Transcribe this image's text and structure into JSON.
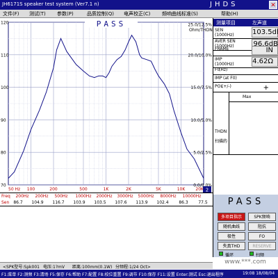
{
  "window": {
    "title": "JH6171S speaker test system (Ver7.1 n)",
    "brand": "JHDS",
    "close_icon": "close-icon"
  },
  "menu": [
    {
      "label": "文件(F)"
    },
    {
      "label": "测试(T)"
    },
    {
      "label": "参数(P)"
    },
    {
      "label": "品质控制(Q)"
    },
    {
      "label": "电声校正(C)"
    },
    {
      "label": "频响曲线标准(S)"
    },
    {
      "label": "帮助(H)"
    }
  ],
  "chart_banner": "PASS",
  "chart_data": {
    "type": "line",
    "title": "",
    "xlabel": "Freq",
    "ylabel_left": "",
    "ylabel_right": "Ohm/THDN",
    "x_scale": "log",
    "xlim": [
      50,
      20000
    ],
    "ylim_left": [
      70,
      120
    ],
    "ylim_right": [
      0,
      25
    ],
    "grid": true,
    "x_ticks": [
      "50 Hz",
      "100",
      "200",
      "500",
      "1K",
      "2K",
      "5K",
      "10K",
      "20K"
    ],
    "y_ticks_left": [
      "120",
      "110",
      "100",
      "90",
      "80",
      "70"
    ],
    "y_ticks_right": [
      "25.0/12.5%",
      "20.0/10.0%",
      "15.0/7.5%",
      "10.0/5.0%",
      "5.0/2.5%",
      "0.0/0.0%"
    ],
    "series": [
      {
        "axis": "left",
        "color": "#12128a",
        "x": [
          50,
          60,
          80,
          100,
          130,
          160,
          200,
          220,
          250,
          300,
          400,
          500,
          600,
          700,
          800,
          900,
          1000,
          1100,
          1200,
          1400,
          1600,
          1800,
          2000,
          2200,
          2500,
          2800,
          3000,
          3500,
          4000,
          4500,
          5000,
          6000,
          7000,
          8000,
          10000,
          12000,
          15000,
          20000
        ],
        "y": [
          72.0,
          74.0,
          80.5,
          87.0,
          93.0,
          98.5,
          106.0,
          111.5,
          115.0,
          111.0,
          107.0,
          105.0,
          103.5,
          103.0,
          103.5,
          103.5,
          103.0,
          104.5,
          106.5,
          108.5,
          109.5,
          111.5,
          114.0,
          116.0,
          114.0,
          110.0,
          109.0,
          108.5,
          108.0,
          105.5,
          103.5,
          101.0,
          98.0,
          93.0,
          86.0,
          81.0,
          78.0,
          72.0
        ]
      }
    ],
    "readout": {
      "freq_label": "Freq",
      "sen_label": "Sen",
      "freqs": [
        "200Hz",
        "200Hz",
        "500Hz",
        "1000Hz",
        "2000Hz",
        "3000Hz",
        "5000Hz",
        "8000Hz",
        "10000Hz"
      ],
      "values": [
        "86.7",
        "104.9",
        "116.7",
        "103.9",
        "103.5",
        "107.6",
        "113.9",
        "102.4",
        "86.3",
        "77.5"
      ]
    },
    "scroll_value": "2"
  },
  "right_panel": {
    "header_left": "测量项目",
    "header_right": "左声道",
    "rows": [
      {
        "label": "SEN",
        "unit": "(1000Hz)",
        "value": "103.5dB"
      },
      {
        "label": "AVER SEN",
        "unit": "(1000Hz)",
        "value": "96.6dB"
      },
      {
        "label": "FRAME",
        "unit": "",
        "value": "IN"
      },
      {
        "label": "IMP",
        "unit": "(1000Hz)",
        "value": "4.62Ω"
      },
      {
        "label": "F0",
        "unit": "(Hz)",
        "value": ""
      },
      {
        "label": "IMP",
        "unit": "(at F0)",
        "value": ""
      },
      {
        "label": "POL",
        "unit": "(+/-)",
        "value": "+"
      }
    ],
    "max_label": "Max",
    "thdn_label": "THDN",
    "distort_label": "扫描的"
  },
  "pass_panel": {
    "title": "PASS",
    "buttons": [
      {
        "label": "多项目指示",
        "style": "red"
      },
      {
        "label": "SPK频响",
        "style": "normal"
      },
      {
        "label": "随机曲线",
        "style": "normal"
      },
      {
        "label": "阻抗",
        "style": "normal"
      },
      {
        "label": "极性",
        "style": "normal"
      },
      {
        "label": "FO",
        "style": "normal"
      },
      {
        "label": "失真THD",
        "style": "normal"
      },
      {
        "label": "RESERVE",
        "style": "disabled"
      }
    ],
    "leds": [
      {
        "label": "循环",
        "color": "#1fb91f"
      },
      {
        "label": "扫频",
        "color": "#1fb91f"
      }
    ]
  },
  "status": {
    "items": [
      "<SPK型号:Spk001",
      "电压:1?mV",
      "距离:100mm(0.1W)",
      "分频程:1/24 Oct>"
    ]
  },
  "hotkeys": "F1:菜单 F2:测频 F3:清场 F5:保存 F6:帮助 F7:配置 F8:校位重置 F9:调节 F10:保存 F11:设置 Enter:测试 Esc:退出程序",
  "clock": "19:08 18/08/04",
  "watermark": "www.***.com"
}
